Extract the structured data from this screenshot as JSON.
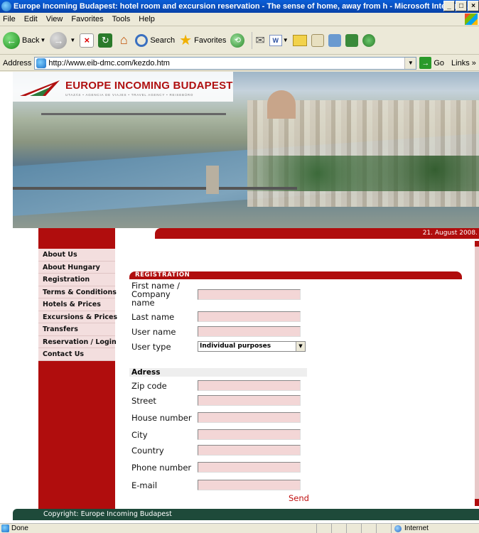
{
  "window": {
    "title": "Europe Incoming Budapest: hotel room and excursion reservation - The sense of home, away from h - Microsoft Internet ..."
  },
  "menu": [
    "File",
    "Edit",
    "View",
    "Favorites",
    "Tools",
    "Help"
  ],
  "toolbar": {
    "back": "Back",
    "search": "Search",
    "favorites": "Favorites",
    "word_icon": "W"
  },
  "address": {
    "label": "Address",
    "url": "http://www.eib-dmc.com/kezdo.htm",
    "go": "Go",
    "links": "Links"
  },
  "site": {
    "logo": "EUROPE INCOMING BUDAPEST",
    "logo_sub": "UTAZÁS • AGENCIA DE VIAJES • TRAVEL AGENCY • REISEBÜRO",
    "date": "21. August 2008.",
    "nav": [
      "About Us",
      "About Hungary",
      "Registration",
      "Terms & Conditions",
      "Hotels & Prices",
      "Excursions & Prices",
      "Transfers",
      "Reservation / Login",
      "Contact Us"
    ],
    "registration_header": "REGISTRATION",
    "fields": {
      "first_name": "First name / Company name",
      "last_name": "Last name",
      "user_name": "User name",
      "user_type": "User type",
      "user_type_value": "Individual purposes"
    },
    "address_header": "Adress",
    "address_fields": {
      "zip": "Zip code",
      "street": "Street",
      "house": "House number",
      "city": "City",
      "country": "Country",
      "phone": "Phone number",
      "email": "E-mail"
    },
    "send": "Send",
    "copyright": "Copyright: Europe Incoming Budapest"
  },
  "status": {
    "text": "Done",
    "zone": "Internet"
  }
}
